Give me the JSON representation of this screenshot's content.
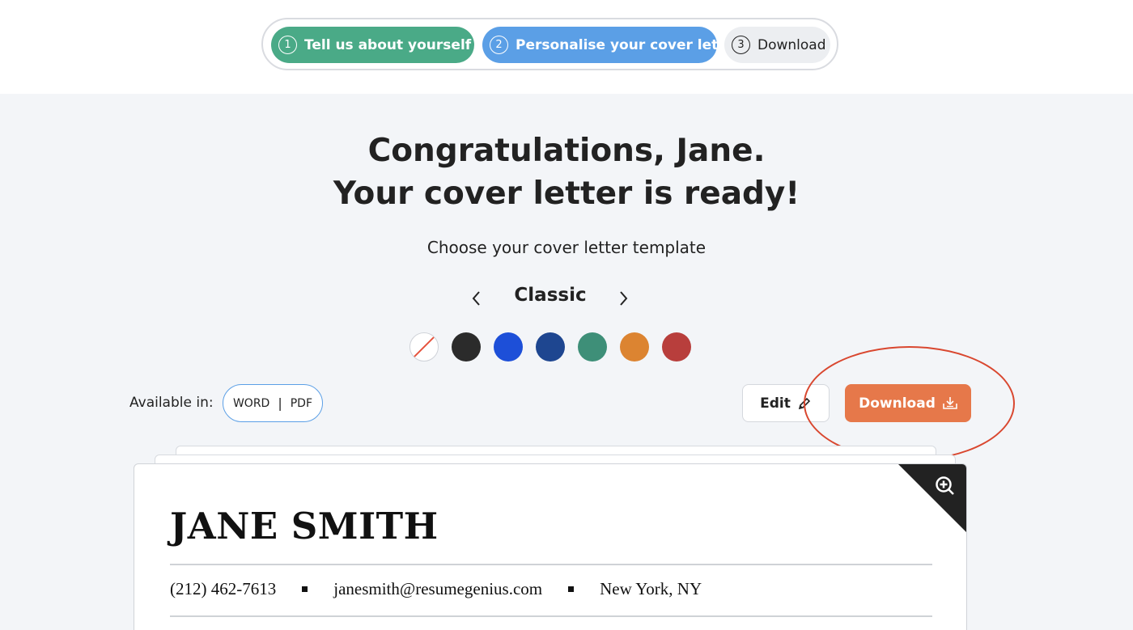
{
  "stepper": {
    "steps": [
      {
        "number": "1",
        "label": "Tell us about yourself",
        "status": "completed"
      },
      {
        "number": "2",
        "label": "Personalise your cover letter",
        "status": "active"
      },
      {
        "number": "3",
        "label": "Download",
        "status": "upcoming"
      }
    ]
  },
  "headline": {
    "line1": "Congratulations, Jane.",
    "line2": "Your cover letter is ready!"
  },
  "template_picker": {
    "prompt": "Choose your cover letter template",
    "current": "Classic",
    "colors": [
      {
        "name": "none",
        "hex": "#ffffff"
      },
      {
        "name": "black",
        "hex": "#2b2b2b"
      },
      {
        "name": "blue",
        "hex": "#1d4fd8"
      },
      {
        "name": "navy",
        "hex": "#1e4690"
      },
      {
        "name": "teal",
        "hex": "#3e8f78"
      },
      {
        "name": "orange",
        "hex": "#dc8431"
      },
      {
        "name": "red",
        "hex": "#b83e3c"
      }
    ]
  },
  "actions": {
    "available_label": "Available in:",
    "formats": [
      "WORD",
      "PDF"
    ],
    "edit_label": "Edit",
    "download_label": "Download"
  },
  "document": {
    "name": "JANE SMITH",
    "phone": "(212) 462-7613",
    "email": "janesmith@resumegenius.com",
    "location": "New York, NY"
  },
  "colors": {
    "step_completed": "#4aaa87",
    "step_active": "#5b9fe6",
    "download_button": "#e6784a",
    "highlight_ring": "#d9472f"
  }
}
